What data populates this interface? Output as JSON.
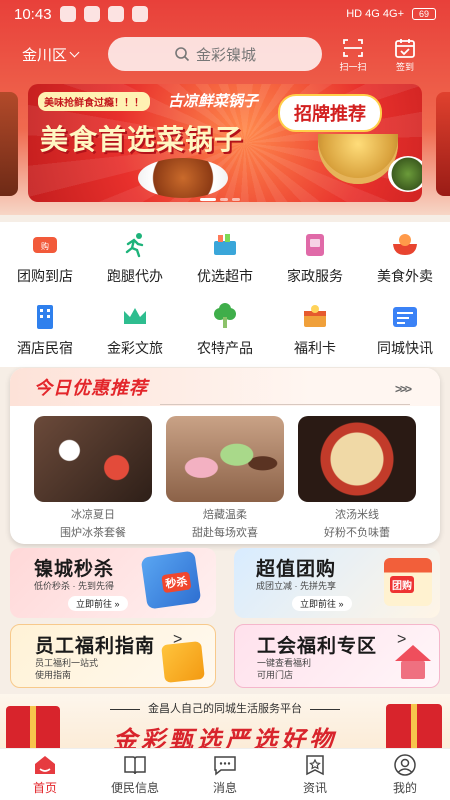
{
  "status": {
    "time": "10:43",
    "icons_right": "HD 4G 4G+",
    "battery": "69"
  },
  "header": {
    "location": "金川区",
    "search_placeholder": "金彩镍城",
    "scan_label": "扫一扫",
    "checkin_label": "签到"
  },
  "banner": {
    "tag": "美味抢鲜食过瘾！！！",
    "subtitle": "古凉鲜菜锅子",
    "title": "美食首选菜锅子",
    "badge": "招牌推荐"
  },
  "categories": [
    {
      "label": "团购到店",
      "icon": "group-buy-icon",
      "color": "#f25a3a"
    },
    {
      "label": "跑腿代办",
      "icon": "runner-icon",
      "color": "#1db37a"
    },
    {
      "label": "优选超市",
      "icon": "basket-icon",
      "color": "#3aa6d9"
    },
    {
      "label": "家政服务",
      "icon": "housekeeping-icon",
      "color": "#e06aa8"
    },
    {
      "label": "美食外卖",
      "icon": "food-bowl-icon",
      "color": "#e8442f"
    },
    {
      "label": "酒店民宿",
      "icon": "hotel-icon",
      "color": "#2f80ed"
    },
    {
      "label": "金彩文旅",
      "icon": "crown-icon",
      "color": "#2ebd8f"
    },
    {
      "label": "农特产品",
      "icon": "vegetable-icon",
      "color": "#3fae4a"
    },
    {
      "label": "福利卡",
      "icon": "benefit-card-icon",
      "color": "#f0a03a"
    },
    {
      "label": "同城快讯",
      "icon": "news-icon",
      "color": "#3b82f6"
    }
  ],
  "today": {
    "title": "今日优惠推荐",
    "arrows": ">>>",
    "deals": [
      {
        "line1": "冰凉夏日",
        "line2": "围炉冰茶套餐"
      },
      {
        "line1": "焙藏温柔",
        "line2": "甜赴每场欢喜"
      },
      {
        "line1": "浓汤米线",
        "line2": "好粉不负味蕾"
      }
    ]
  },
  "promos": {
    "seckill": {
      "title": "镍城秒杀",
      "sub": "低价秒杀 · 先到先得",
      "button": "立即前往 »",
      "ill": "秒杀"
    },
    "group": {
      "title": "超值团购",
      "sub": "成团立减 · 先拼先享",
      "button": "立即前往 »",
      "ill": "团购"
    },
    "guide": {
      "title": "员工福利指南",
      "sub1": "员工福利一站式",
      "sub2": "使用指南",
      "arrow": ">"
    },
    "union": {
      "title": "工会福利专区",
      "sub1": "一键查看福利",
      "sub2": "可用门店",
      "arrow": ">"
    }
  },
  "bottom_banner": {
    "sub": "金昌人自己的同城生活服务平台",
    "main": "金彩甄选严选好物"
  },
  "tabs": [
    {
      "label": "首页",
      "icon": "home-icon",
      "active": true
    },
    {
      "label": "便民信息",
      "icon": "book-icon",
      "active": false
    },
    {
      "label": "消息",
      "icon": "message-icon",
      "active": false
    },
    {
      "label": "资讯",
      "icon": "star-bookmark-icon",
      "active": false
    },
    {
      "label": "我的",
      "icon": "user-icon",
      "active": false
    }
  ],
  "colors": {
    "brand_red": "#e3262b",
    "accent_gold": "#f7c54d"
  }
}
